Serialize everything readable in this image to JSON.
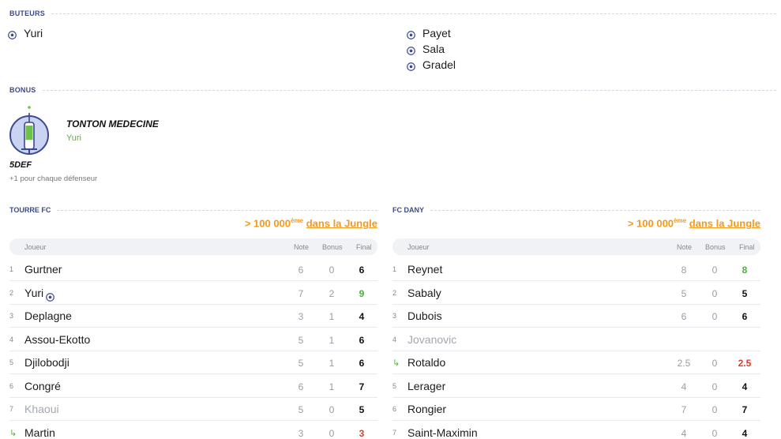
{
  "scorers": {
    "title": "BUTEURS",
    "home": [
      "Yuri"
    ],
    "away": [
      "Payet",
      "Sala",
      "Gradel"
    ]
  },
  "bonus": {
    "title": "BONUS",
    "name": "TONTON MEDECINE",
    "player": "Yuri",
    "code": "5DEF",
    "description": "+1 pour chaque défenseur"
  },
  "columns": {
    "player": "Joueur",
    "note": "Note",
    "bonus": "Bonus",
    "final": "Final"
  },
  "teams": [
    {
      "name": "TOURRE FC",
      "rank_prefix": "> 100 000",
      "rank_sup": "ème",
      "rank_link": "dans la Jungle",
      "rows": [
        {
          "num": "1",
          "name": "Gurtner",
          "note": "6",
          "bonus": "0",
          "final": "6",
          "final_state": "normal"
        },
        {
          "num": "2",
          "name": "Yuri",
          "note": "7",
          "bonus": "2",
          "final": "9",
          "final_state": "good",
          "scored": true
        },
        {
          "num": "3",
          "name": "Deplagne",
          "note": "3",
          "bonus": "1",
          "final": "4",
          "final_state": "normal"
        },
        {
          "num": "4",
          "name": "Assou-Ekotto",
          "note": "5",
          "bonus": "1",
          "final": "6",
          "final_state": "normal"
        },
        {
          "num": "5",
          "name": "Djilobodji",
          "note": "5",
          "bonus": "1",
          "final": "6",
          "final_state": "normal"
        },
        {
          "num": "6",
          "name": "Congré",
          "note": "6",
          "bonus": "1",
          "final": "7",
          "final_state": "normal"
        },
        {
          "num": "7",
          "name": "Khaoui",
          "note": "5",
          "bonus": "0",
          "final": "5",
          "final_state": "normal",
          "faded": true
        },
        {
          "num": "",
          "substitute": true,
          "name": "Martin",
          "note": "3",
          "bonus": "0",
          "final": "3",
          "final_state": "bad"
        }
      ]
    },
    {
      "name": "FC DANY",
      "rank_prefix": "> 100 000",
      "rank_sup": "ème",
      "rank_link": "dans la Jungle",
      "rows": [
        {
          "num": "1",
          "name": "Reynet",
          "note": "8",
          "bonus": "0",
          "final": "8",
          "final_state": "good"
        },
        {
          "num": "2",
          "name": "Sabaly",
          "note": "5",
          "bonus": "0",
          "final": "5",
          "final_state": "normal"
        },
        {
          "num": "3",
          "name": "Dubois",
          "note": "6",
          "bonus": "0",
          "final": "6",
          "final_state": "normal"
        },
        {
          "num": "4",
          "name": "Jovanovic",
          "note": "",
          "bonus": "",
          "final": "",
          "final_state": "normal",
          "faded": true
        },
        {
          "num": "",
          "substitute": true,
          "name": "Rotaldo",
          "note": "2.5",
          "bonus": "0",
          "final": "2.5",
          "final_state": "bad"
        },
        {
          "num": "5",
          "name": "Lerager",
          "note": "4",
          "bonus": "0",
          "final": "4",
          "final_state": "normal"
        },
        {
          "num": "6",
          "name": "Rongier",
          "note": "7",
          "bonus": "0",
          "final": "7",
          "final_state": "normal"
        },
        {
          "num": "7",
          "name": "Saint-Maximin",
          "note": "4",
          "bonus": "0",
          "final": "4",
          "final_state": "normal"
        }
      ]
    }
  ],
  "colors": {
    "accent": "#3c4a8c",
    "rank": "#f29a1f",
    "good": "#4caf3a",
    "bad": "#e23a2c"
  }
}
